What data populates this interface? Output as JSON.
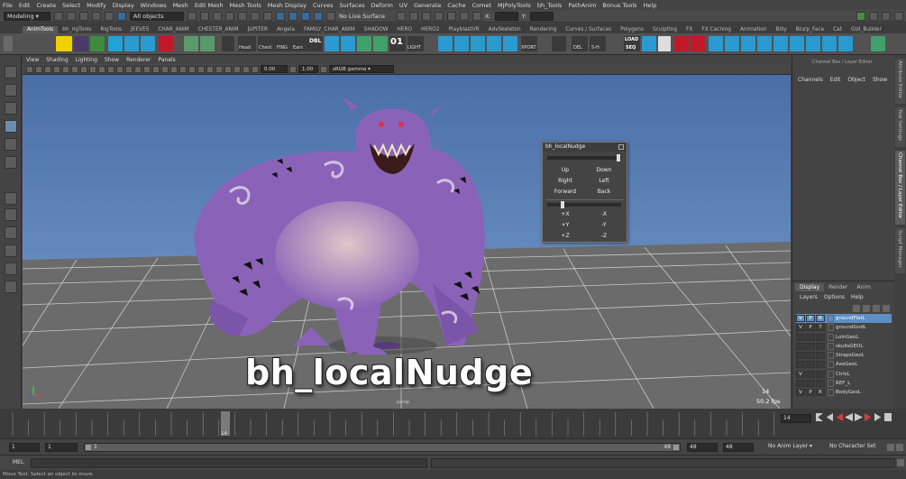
{
  "menubar": [
    "File",
    "Edit",
    "Create",
    "Select",
    "Modify",
    "Display",
    "Windows",
    "Mesh",
    "Edit Mesh",
    "Mesh Tools",
    "Mesh Display",
    "Curves",
    "Surfaces",
    "Deform",
    "UV",
    "Generate",
    "Cache",
    "Comet",
    "MJPolyTools",
    "bh_Tools",
    "PathAnim",
    "Bonus Tools",
    "Help"
  ],
  "status": {
    "menuset": "Modeling",
    "select_mode": "All objects",
    "live_surface": "No Live Surface",
    "x_label": "X:",
    "y_label": "Y:"
  },
  "shelf_tabs": [
    "AnimTools",
    "bh_rigTools",
    "RigTools",
    "JEEVES",
    "CHAR_ANIM",
    "CHESTER_ANIM",
    "JUPITER",
    "Angela",
    "FAMILY_CHAR_ANIM",
    "SHADOW",
    "HERO",
    "HERO2",
    "PlayblastVR",
    "AdvSkeleton",
    "Rendering",
    "Curves / Surfaces",
    "Polygons",
    "Sculpting",
    "FX",
    "FX Caching",
    "Animation",
    "Billy",
    "Blurp_Face",
    "Cat",
    "GUI_Builder"
  ],
  "shelf_labels": {
    "head": "Head",
    "chest": "Chest",
    "fing": "FING",
    "ears": "Ears",
    "dbl": "DBL",
    "num": "01",
    "light": "LIGHT",
    "load": "LOAD",
    "seq": "SEQ",
    "del": "DEL",
    "sh": "S-H",
    "xport": "XPORT"
  },
  "panel_menu": [
    "View",
    "Shading",
    "Lighting",
    "Show",
    "Renderer",
    "Panels"
  ],
  "panel_bar": {
    "field1": "0.00",
    "field2": "1.00",
    "colorspace": "sRGB gamma"
  },
  "viewport": {
    "fps": "50.2 fps",
    "frame": "14",
    "persp": "persp"
  },
  "nudge_window": {
    "title": "bh_localNudge",
    "buttons": [
      [
        "Up",
        "Down"
      ],
      [
        "Right",
        "Left"
      ],
      [
        "Forward",
        "Back"
      ]
    ],
    "axes": [
      [
        "+X",
        "-X"
      ],
      [
        "+Y",
        "-Y"
      ],
      [
        "+Z",
        "-Z"
      ]
    ]
  },
  "channel_box": {
    "header": "Channel Box / Layer Editor",
    "menu": [
      "Channels",
      "Edit",
      "Object",
      "Show"
    ]
  },
  "layer_editor": {
    "tabs": [
      "Display",
      "Render",
      "Anim"
    ],
    "menu": [
      "Layers",
      "Options",
      "Help"
    ],
    "layers": [
      {
        "v": "V",
        "p": "P",
        "r": "R",
        "name": "groundFlatL",
        "selected": true
      },
      {
        "v": "V",
        "p": "P",
        "r": "T",
        "name": "groundGndL",
        "selected": false
      },
      {
        "v": "",
        "p": "",
        "r": "",
        "name": "LoinGeoL",
        "selected": false
      },
      {
        "v": "",
        "p": "",
        "r": "",
        "name": "skullsGEOL",
        "selected": false
      },
      {
        "v": "",
        "p": "",
        "r": "",
        "name": "StrapsGeoL",
        "selected": false
      },
      {
        "v": "",
        "p": "",
        "r": "",
        "name": "AxeGeoL",
        "selected": false
      },
      {
        "v": "V",
        "p": "",
        "r": "",
        "name": "CtrlsL",
        "selected": false
      },
      {
        "v": "",
        "p": "",
        "r": "",
        "name": "REF_L",
        "selected": false
      },
      {
        "v": "V",
        "p": "P",
        "r": "R",
        "name": "BodyGeoL",
        "selected": false
      }
    ]
  },
  "side_tabs": [
    "Attribute Editor",
    "Tool Settings",
    "Channel Box / Layer Editor",
    "Script Manager"
  ],
  "timeslider": {
    "current_frame": "14",
    "frame_field": "14"
  },
  "range": {
    "start": "1",
    "start2": "1",
    "slider_start": "1",
    "end_marker": "48",
    "end": "48",
    "end2": "48",
    "anim_layer": "No Anim Layer",
    "char_set": "No Character Set"
  },
  "mel": {
    "label": "MEL"
  },
  "help_line": "Move Tool: Select an object to move.",
  "overlay_title": "bh_localNudge",
  "colors": {
    "sky_top": "#4a6ea6",
    "sky_bottom": "#7aa0d2",
    "ground": "#6b6b6b",
    "creature": "#8a63b8",
    "selected_layer": "#5d8fc4"
  }
}
